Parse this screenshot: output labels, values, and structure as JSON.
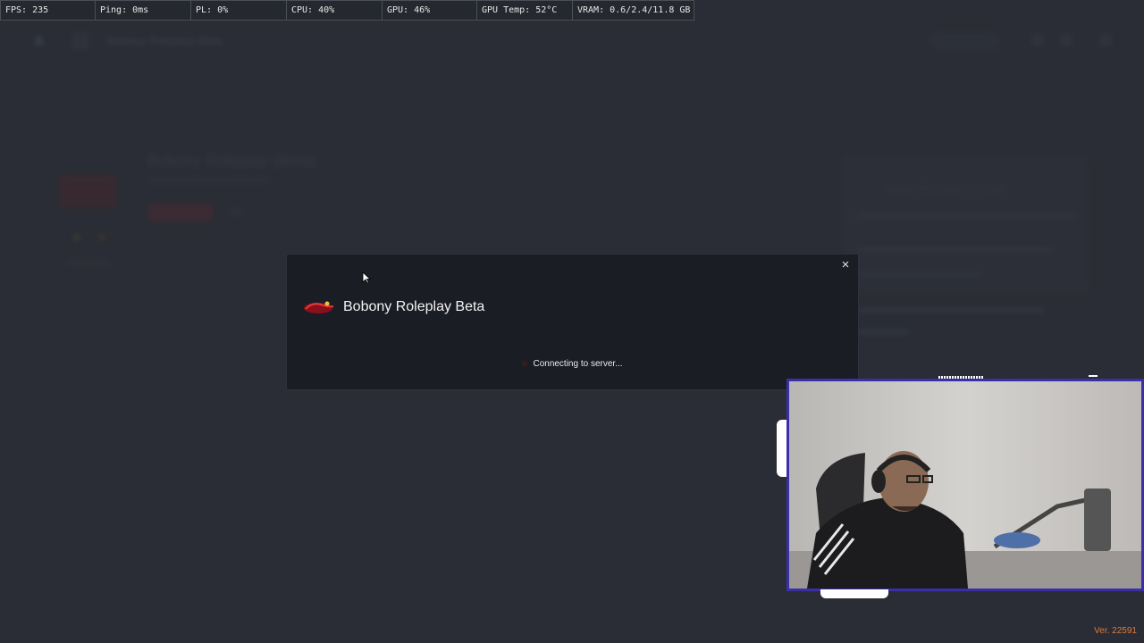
{
  "perf_overlay": {
    "fps": "FPS: 235",
    "ping": "Ping: 0ms",
    "pl": "PL: 0%",
    "cpu": "CPU: 40%",
    "gpu": "GPU: 46%",
    "gpu_temp": "GPU Temp: 52°C",
    "vram": "VRAM: 0.6/2.4/11.8 GB"
  },
  "background": {
    "title": "Bobony Roleplay Beta",
    "server_title": "Bobony Roleplay (Beta)",
    "panel_text": "Server information is limited"
  },
  "modal": {
    "title": "Bobony Roleplay Beta",
    "status": "Connecting to server...",
    "close_icon": "×"
  },
  "footer": {
    "version": "Ver. 22591"
  },
  "colors": {
    "background": "#2a2d35",
    "modal_bg": "#1b1d25",
    "webcam_border": "#3a2fa8",
    "version_text": "#e07a3a"
  }
}
